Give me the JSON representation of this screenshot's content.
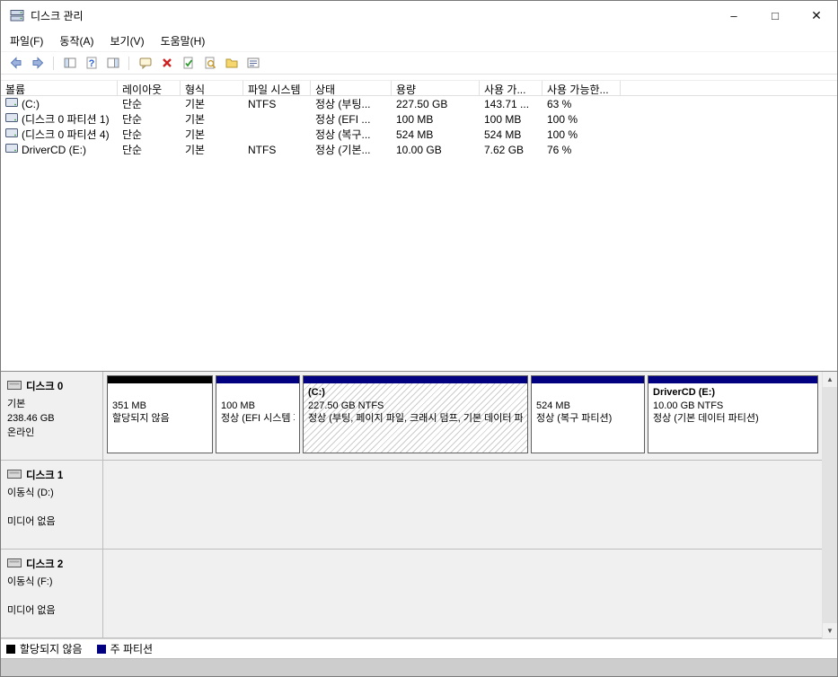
{
  "window": {
    "title": "디스크 관리",
    "minimize": "–",
    "maximize": "□",
    "close": "✕"
  },
  "menubar": {
    "items": [
      {
        "label": "파일(F)"
      },
      {
        "label": "동작(A)"
      },
      {
        "label": "보기(V)"
      },
      {
        "label": "도움말(H)"
      }
    ]
  },
  "toolbar": {
    "icons": [
      "back-icon",
      "forward-icon",
      "console-tree-icon",
      "help-icon",
      "action-pane-icon",
      "callout-icon",
      "delete-icon",
      "check-document-icon",
      "inspect-document-icon",
      "folder-icon",
      "list-view-icon"
    ]
  },
  "volume_table": {
    "columns": [
      {
        "label": "볼륨"
      },
      {
        "label": "레이아웃"
      },
      {
        "label": "형식"
      },
      {
        "label": "파일 시스템"
      },
      {
        "label": "상태"
      },
      {
        "label": "용량"
      },
      {
        "label": "사용 가..."
      },
      {
        "label": "사용 가능한..."
      }
    ],
    "rows": [
      {
        "volume": "(C:)",
        "layout": "단순",
        "type": "기본",
        "filesystem": "NTFS",
        "status": "정상 (부팅...",
        "capacity": "227.50 GB",
        "free_space": "143.71 ...",
        "percent_free": "63 %"
      },
      {
        "volume": "(디스크 0 파티션 1)",
        "layout": "단순",
        "type": "기본",
        "filesystem": "",
        "status": "정상 (EFI ...",
        "capacity": "100 MB",
        "free_space": "100 MB",
        "percent_free": "100 %"
      },
      {
        "volume": "(디스크 0 파티션 4)",
        "layout": "단순",
        "type": "기본",
        "filesystem": "",
        "status": "정상 (복구...",
        "capacity": "524 MB",
        "free_space": "524 MB",
        "percent_free": "100 %"
      },
      {
        "volume": "DriverCD (E:)",
        "layout": "단순",
        "type": "기본",
        "filesystem": "NTFS",
        "status": "정상 (기본...",
        "capacity": "10.00 GB",
        "free_space": "7.62 GB",
        "percent_free": "76 %"
      }
    ]
  },
  "disks": [
    {
      "name": "디스크 0",
      "line1": "기본",
      "line2": "238.46 GB",
      "line3": "온라인",
      "partitions": [
        {
          "name": "",
          "size": "351 MB",
          "status": "할당되지 않음",
          "kind": "unallocated"
        },
        {
          "name": "",
          "size": "100 MB",
          "status": "정상 (EFI 시스템 파티션)",
          "kind": "primary"
        },
        {
          "name": "(C:)",
          "size": "227.50 GB NTFS",
          "status": "정상 (부팅, 페이지 파일, 크래시 덤프, 기본 데이터 파티션)",
          "kind": "primary",
          "selected": true
        },
        {
          "name": "",
          "size": "524 MB",
          "status": "정상 (복구 파티션)",
          "kind": "primary"
        },
        {
          "name": "DriverCD (E:)",
          "size": "10.00 GB NTFS",
          "status": "정상 (기본 데이터 파티션)",
          "kind": "primary"
        }
      ]
    },
    {
      "name": "디스크 1",
      "line1": "이동식 (D:)",
      "line2": "",
      "line3": "미디어 없음",
      "partitions": []
    },
    {
      "name": "디스크 2",
      "line1": "이동식 (F:)",
      "line2": "",
      "line3": "미디어 없음",
      "partitions": []
    }
  ],
  "legend": {
    "items": [
      {
        "label": "할당되지 않음",
        "color": "#000000"
      },
      {
        "label": "주 파티션",
        "color": "#000080"
      }
    ]
  },
  "scrollbar": {
    "up": "▲",
    "down": "▼"
  },
  "colors": {
    "primary_partition": "#000080",
    "unallocated": "#000000"
  }
}
